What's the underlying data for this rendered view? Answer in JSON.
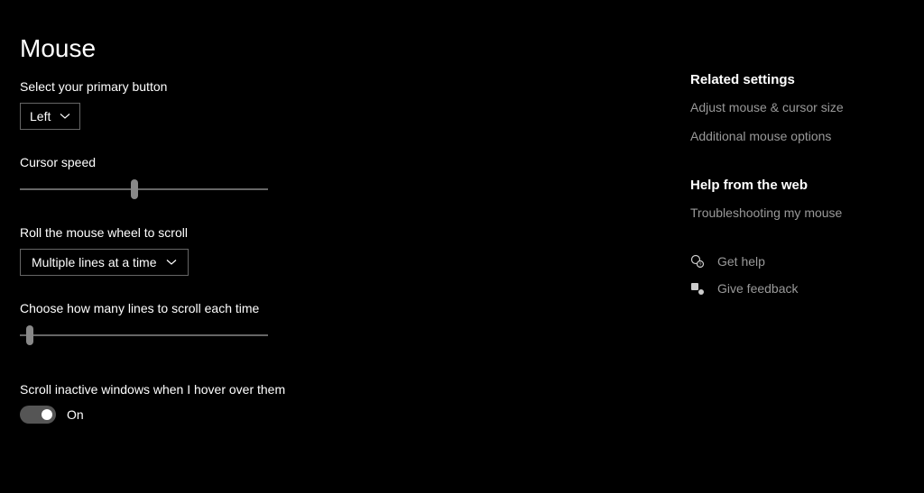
{
  "page": {
    "title": "Mouse"
  },
  "settings": {
    "primaryButton": {
      "label": "Select your primary button",
      "value": "Left"
    },
    "cursorSpeed": {
      "label": "Cursor speed",
      "percent": 46
    },
    "scrollMode": {
      "label": "Roll the mouse wheel to scroll",
      "value": "Multiple lines at a time"
    },
    "scrollLines": {
      "label": "Choose how many lines to scroll each time",
      "percent": 4
    },
    "inactiveScroll": {
      "label": "Scroll inactive windows when I hover over them",
      "state": "On"
    }
  },
  "sidebar": {
    "related": {
      "heading": "Related settings",
      "links": {
        "cursorSize": "Adjust mouse & cursor size",
        "additional": "Additional mouse options"
      }
    },
    "help": {
      "heading": "Help from the web",
      "links": {
        "troubleshoot": "Troubleshooting my mouse"
      }
    },
    "actions": {
      "getHelp": "Get help",
      "feedback": "Give feedback"
    }
  }
}
